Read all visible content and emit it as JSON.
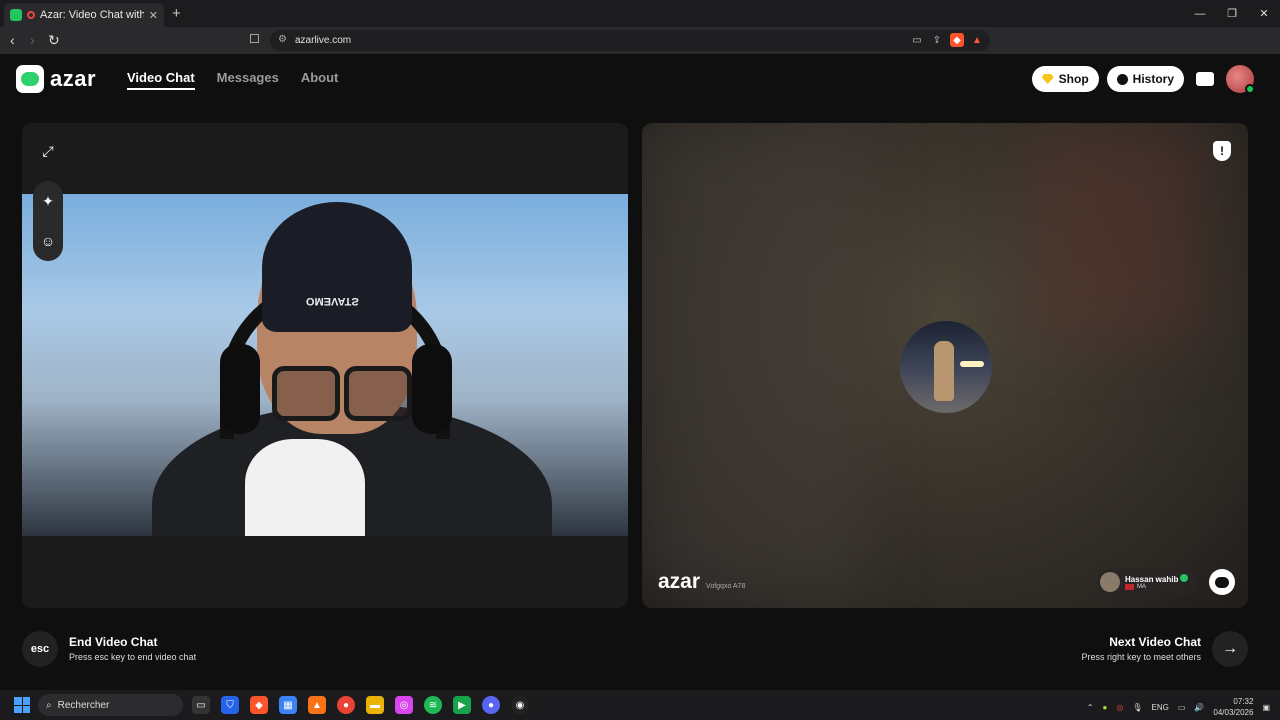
{
  "browser": {
    "tab_title": "Azar: Video Chat with New Pe",
    "url": "azarlive.com",
    "new_tab": "+",
    "controls": {
      "minimize": "—",
      "restore": "❐",
      "close": "✕"
    }
  },
  "header": {
    "logo_text": "azar",
    "nav": {
      "video_chat": "Video Chat",
      "messages": "Messages",
      "about": "About"
    },
    "shop_label": "Shop",
    "history_label": "History"
  },
  "left_panel": {
    "beanie_text": "ƧTAVEMO"
  },
  "right_panel": {
    "watermark_logo": "azar",
    "watermark_code": "Vofgqxo A78",
    "partner": {
      "name": "Hassan wahib",
      "country": "MA"
    }
  },
  "controls": {
    "esc_label": "esc",
    "end_title": "End Video Chat",
    "end_sub": "Press esc key to end video chat",
    "next_title": "Next Video Chat",
    "next_sub": "Press right key to meet others",
    "next_arrow": "→"
  },
  "taskbar": {
    "search_placeholder": "Rechercher",
    "language": "ENG",
    "time": "07:32",
    "date": "04/03/2026"
  },
  "colors": {
    "accent": "#2fd06e",
    "verified": "#22c55e",
    "shop_gem": "#f5c518"
  }
}
